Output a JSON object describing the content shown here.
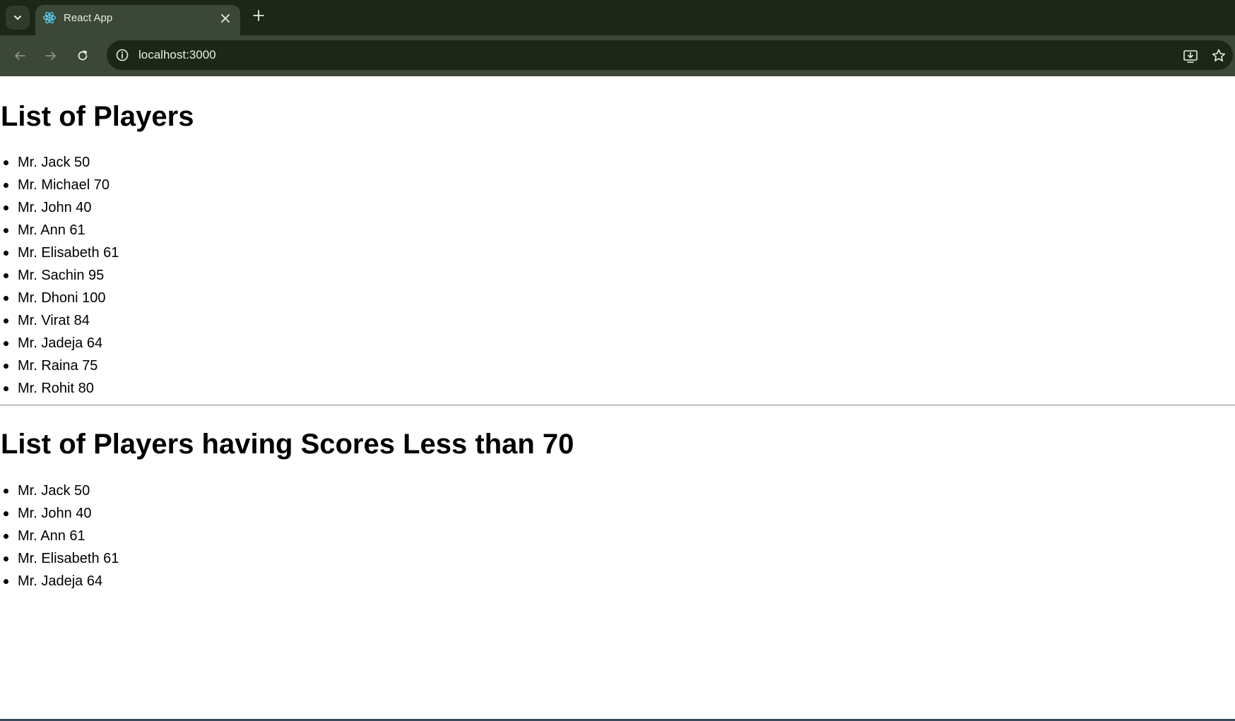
{
  "browser": {
    "tab_title": "React App",
    "url": "localhost:3000",
    "colors": {
      "frame": "#1c2719",
      "toolbar": "#3b4737",
      "text": "#e8ecdf"
    },
    "icons": [
      "tab-search-icon",
      "react-favicon-icon",
      "close-icon",
      "plus-icon",
      "back-arrow-icon",
      "forward-arrow-icon",
      "reload-icon",
      "site-info-icon",
      "install-app-icon",
      "bookmark-star-icon"
    ]
  },
  "page": {
    "heading_all": "List of Players",
    "players": [
      "Mr. Jack 50",
      "Mr. Michael 70",
      "Mr. John 40",
      "Mr. Ann 61",
      "Mr. Elisabeth 61",
      "Mr. Sachin 95",
      "Mr. Dhoni 100",
      "Mr. Virat 84",
      "Mr. Jadeja 64",
      "Mr. Raina 75",
      "Mr. Rohit 80"
    ],
    "heading_filtered": "List of Players having Scores Less than 70",
    "filtered_players": [
      "Mr. Jack 50",
      "Mr. John 40",
      "Mr. Ann 61",
      "Mr. Elisabeth 61",
      "Mr. Jadeja 64"
    ]
  }
}
